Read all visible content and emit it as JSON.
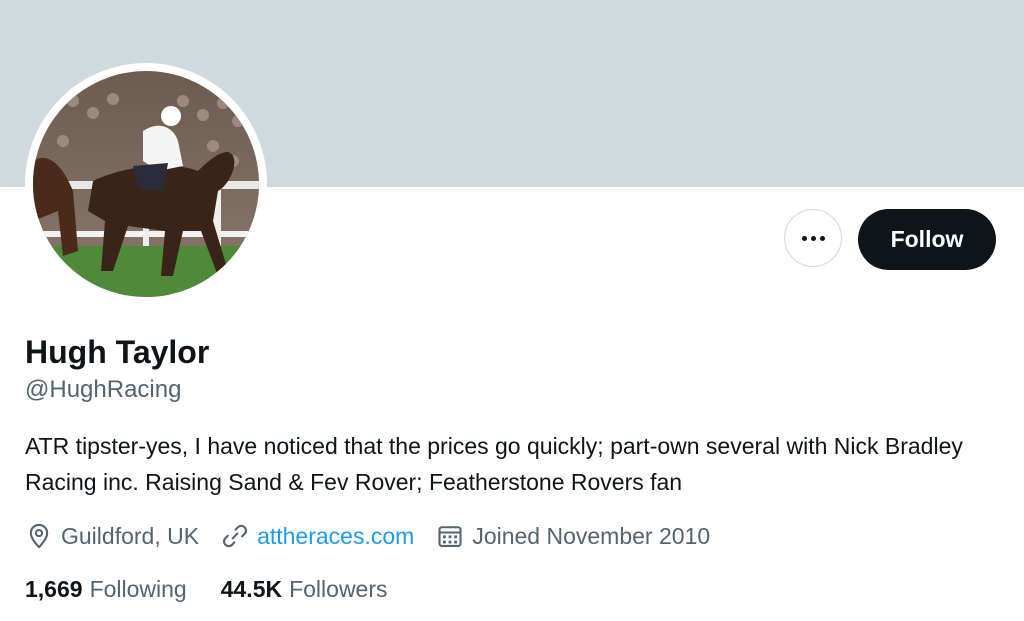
{
  "profile": {
    "display_name": "Hugh Taylor",
    "handle": "@HughRacing",
    "bio": "ATR tipster-yes, I have noticed that the prices go quickly; part-own several with Nick Bradley Racing inc. Raising Sand & Fev Rover; Featherstone Rovers fan",
    "location": "Guildford, UK",
    "website": "attheraces.com",
    "joined": "Joined November 2010",
    "avatar_icon": "horse-racing-photo"
  },
  "actions": {
    "follow_label": "Follow",
    "more_icon": "more-horizontal-icon"
  },
  "stats": {
    "following_count": "1,669",
    "following_label": "Following",
    "followers_count": "44.5K",
    "followers_label": "Followers"
  },
  "colors": {
    "banner": "#cfd9de",
    "link": "#1d9bf0",
    "secondary_text": "#536471",
    "follow_button": "#0f1419"
  }
}
